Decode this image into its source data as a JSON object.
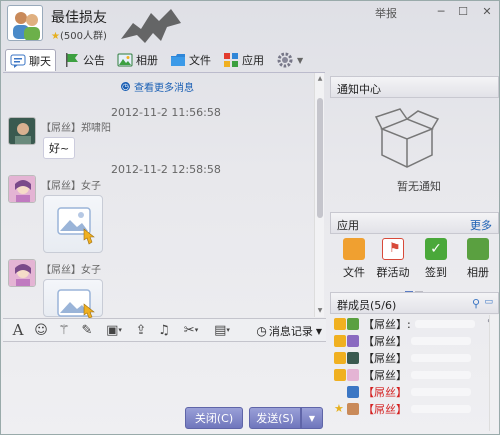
{
  "header": {
    "group_name": "最佳损友",
    "group_meta": "(500人群)",
    "report_label": "举报"
  },
  "tabs": [
    {
      "label": "聊天",
      "icon": "chat-bubble-icon"
    },
    {
      "label": "公告",
      "icon": "flag-icon"
    },
    {
      "label": "相册",
      "icon": "photo-album-icon"
    },
    {
      "label": "文件",
      "icon": "folder-icon"
    },
    {
      "label": "应用",
      "icon": "app-grid-icon"
    }
  ],
  "chat": {
    "more_messages": "查看更多消息",
    "messages": [
      {
        "time": "2012-11-2 11:56:58",
        "sender": "【屌丝】郑啸阳",
        "text": "好~"
      },
      {
        "time": "2012-11-2 12:58:58",
        "sender": "【屌丝】女子",
        "text": ""
      },
      {
        "time": "",
        "sender": "【屌丝】女子",
        "text": ""
      }
    ]
  },
  "format_bar": {
    "history_label": "消息记录"
  },
  "buttons": {
    "close": "关闭(C)",
    "send": "发送(S)"
  },
  "notice": {
    "title": "通知中心",
    "empty": "暂无通知"
  },
  "apps": {
    "title": "应用",
    "more": "更多",
    "items": [
      {
        "label": "文件",
        "color": "#f0a030"
      },
      {
        "label": "群活动",
        "color": "#d84a3a"
      },
      {
        "label": "签到",
        "color": "#4aa83a"
      },
      {
        "label": "相册",
        "color": "#5aa040"
      }
    ]
  },
  "members": {
    "title": "群成员(5/6)",
    "list": [
      {
        "name": "【屌丝】:",
        "red": false
      },
      {
        "name": "【屌丝】",
        "red": false
      },
      {
        "name": "【屌丝】",
        "red": false
      },
      {
        "name": "【屌丝】",
        "red": false
      },
      {
        "name": "【屌丝】",
        "red": true
      },
      {
        "name": "【屌丝】",
        "red": true
      }
    ]
  },
  "colors": {
    "accent_blue": "#1a5fb4",
    "button_purple": "#7b82c8",
    "member_red": "#d42020"
  }
}
